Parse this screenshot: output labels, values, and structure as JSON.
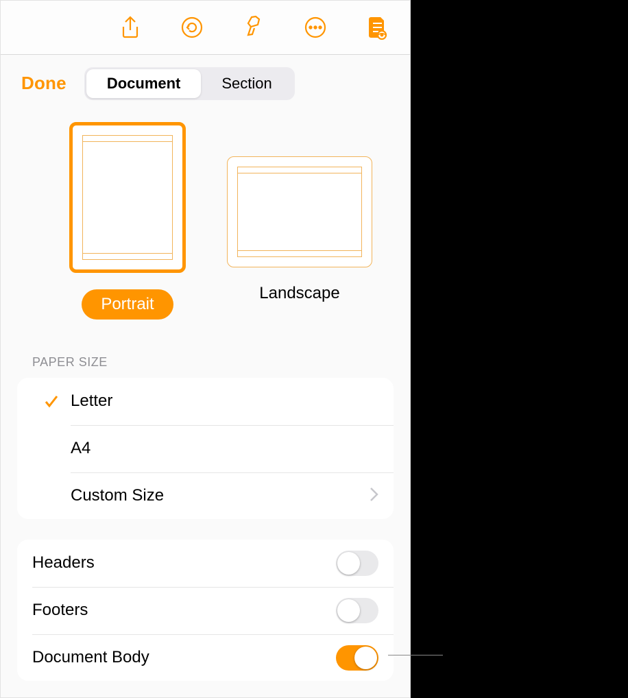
{
  "colors": {
    "accent": "#ff9500"
  },
  "toolbar": {
    "icons": [
      "share-icon",
      "undo-icon",
      "format-brush-icon",
      "more-icon",
      "document-inspector-icon"
    ]
  },
  "header": {
    "done": "Done",
    "tabs": [
      {
        "label": "Document",
        "active": true
      },
      {
        "label": "Section",
        "active": false
      }
    ]
  },
  "orientation": {
    "options": [
      {
        "label": "Portrait",
        "selected": true
      },
      {
        "label": "Landscape",
        "selected": false
      }
    ]
  },
  "paper_size": {
    "heading": "PAPER SIZE",
    "items": [
      {
        "label": "Letter",
        "checked": true,
        "disclosure": false
      },
      {
        "label": "A4",
        "checked": false,
        "disclosure": false
      },
      {
        "label": "Custom Size",
        "checked": false,
        "disclosure": true
      }
    ]
  },
  "switches": [
    {
      "label": "Headers",
      "on": false
    },
    {
      "label": "Footers",
      "on": false
    },
    {
      "label": "Document Body",
      "on": true
    }
  ]
}
